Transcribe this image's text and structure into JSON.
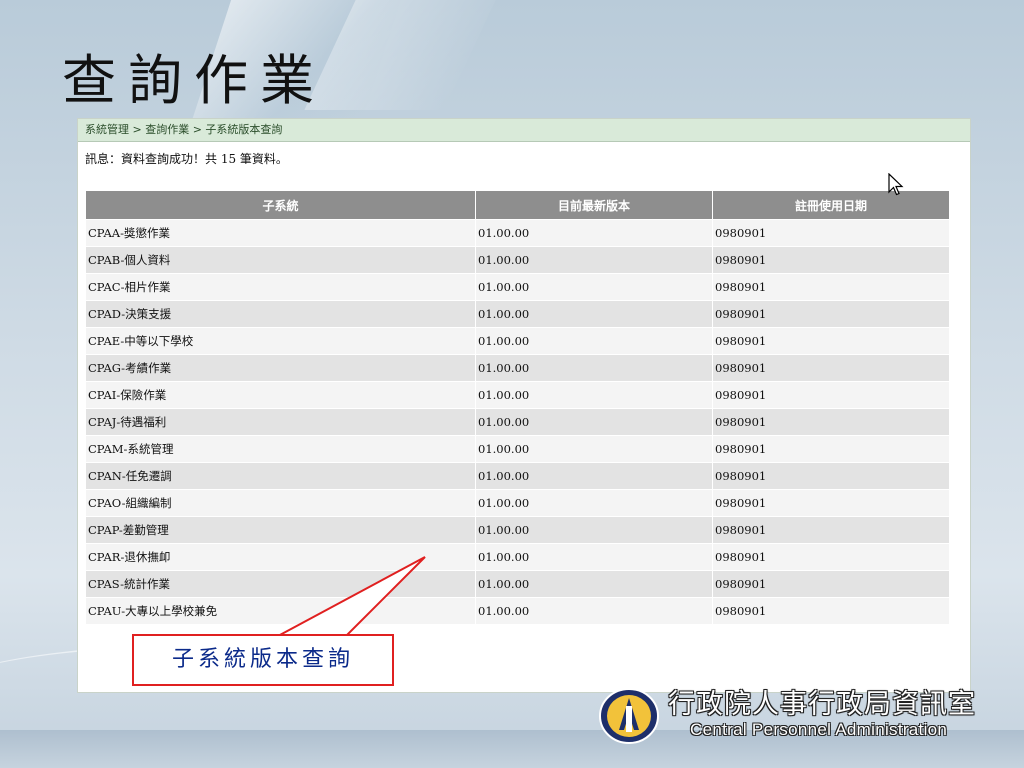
{
  "slide": {
    "title": "查詢作業"
  },
  "breadcrumb": "系統管理 > 查詢作業 > 子系統版本查詢",
  "message": "訊息：資料查詢成功！共 15 筆資料。",
  "table": {
    "headers": [
      "子系統",
      "目前最新版本",
      "註冊使用日期"
    ],
    "rows": [
      [
        "CPAA-獎懲作業",
        "01.00.00",
        "0980901"
      ],
      [
        "CPAB-個人資料",
        "01.00.00",
        "0980901"
      ],
      [
        "CPAC-相片作業",
        "01.00.00",
        "0980901"
      ],
      [
        "CPAD-決策支援",
        "01.00.00",
        "0980901"
      ],
      [
        "CPAE-中等以下學校",
        "01.00.00",
        "0980901"
      ],
      [
        "CPAG-考績作業",
        "01.00.00",
        "0980901"
      ],
      [
        "CPAI-保險作業",
        "01.00.00",
        "0980901"
      ],
      [
        "CPAJ-待遇福利",
        "01.00.00",
        "0980901"
      ],
      [
        "CPAM-系統管理",
        "01.00.00",
        "0980901"
      ],
      [
        "CPAN-任免遷調",
        "01.00.00",
        "0980901"
      ],
      [
        "CPAO-組織編制",
        "01.00.00",
        "0980901"
      ],
      [
        "CPAP-差勤管理",
        "01.00.00",
        "0980901"
      ],
      [
        "CPAR-退休撫卹",
        "01.00.00",
        "0980901"
      ],
      [
        "CPAS-統計作業",
        "01.00.00",
        "0980901"
      ],
      [
        "CPAU-大專以上學校兼免",
        "01.00.00",
        "0980901"
      ]
    ]
  },
  "callout": {
    "text": "子系統版本查詢",
    "border_color": "#e02020",
    "text_color": "#0b2a8a"
  },
  "footer": {
    "org_cn": "行政院人事行政局資訊室",
    "org_en": "Central Personnel Administration",
    "logo_icon": "agency-emblem-icon"
  },
  "cursor_icon": "mouse-pointer-icon"
}
